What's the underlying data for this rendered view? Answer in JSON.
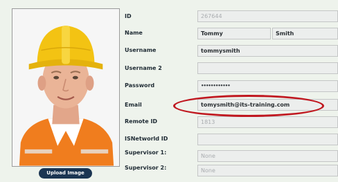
{
  "photo": {
    "alt_icon": "profile-photo"
  },
  "upload_button": "Upload Image",
  "labels": {
    "id": "ID",
    "name": "Name",
    "username": "Username",
    "username2": "Username 2",
    "password": "Password",
    "email": "Email",
    "remote_id": "Remote ID",
    "isnetworld_id": "ISNetworld ID",
    "supervisor1": "Supervisor 1:",
    "supervisor2": "Supervisor 2:"
  },
  "values": {
    "id": "267644",
    "first_name": "Tommy",
    "last_name": "Smith",
    "username": "tommysmith",
    "username2": "",
    "password": "••••••••••••",
    "email": "tomysmith@its-training.com",
    "remote_id": "1813",
    "isnetworld_id": "",
    "supervisor1": "None",
    "supervisor2": "None"
  },
  "colors": {
    "highlight": "#c01820",
    "button_bg": "#1b3552",
    "hardhat": "#f3c313",
    "vest": "#f07d1e"
  }
}
